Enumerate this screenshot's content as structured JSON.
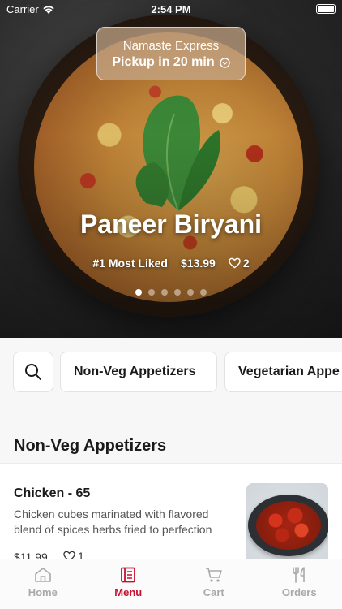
{
  "status_bar": {
    "carrier": "Carrier",
    "time": "2:54 PM"
  },
  "restaurant": {
    "name": "Namaste Express",
    "pickup": "Pickup in 20 min"
  },
  "featured": {
    "title": "Paneer Biryani",
    "badge": "#1 Most Liked",
    "price": "$13.99",
    "likes": "2",
    "slides": 6,
    "active_slide": 0
  },
  "categories": {
    "chips": [
      "Non-Veg Appetizers",
      "Vegetarian Appe"
    ]
  },
  "section": {
    "title": "Non-Veg Appetizers"
  },
  "items": [
    {
      "name": "Chicken - 65",
      "description": "Chicken cubes marinated with flavored blend of spices herbs fried to perfection",
      "price": "$11.99",
      "likes": "1"
    }
  ],
  "tabs": [
    {
      "label": "Home",
      "icon": "home-icon"
    },
    {
      "label": "Menu",
      "icon": "menu-icon"
    },
    {
      "label": "Cart",
      "icon": "cart-icon"
    },
    {
      "label": "Orders",
      "icon": "fork-knife-icon"
    }
  ],
  "colors": {
    "accent": "#c8102e",
    "inactive": "#a9a9a9"
  }
}
